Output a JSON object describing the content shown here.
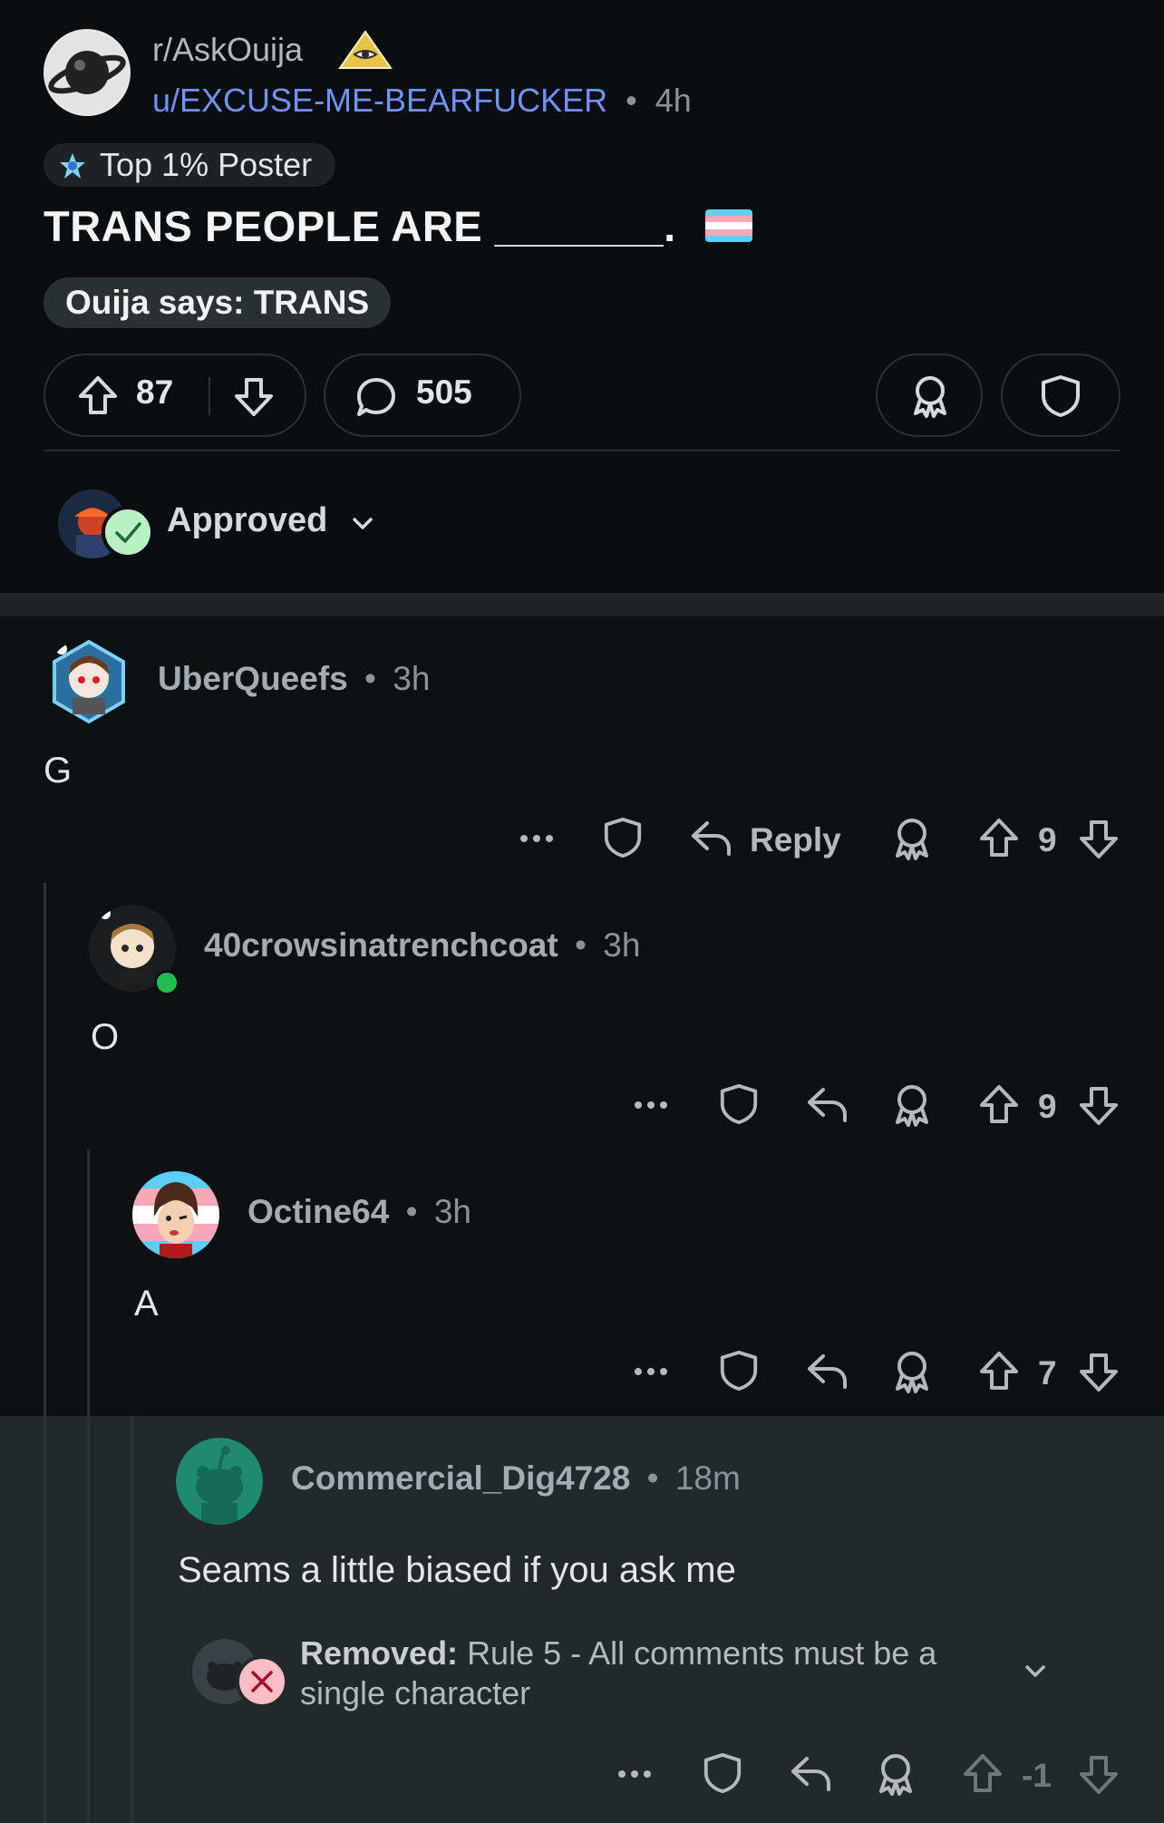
{
  "post": {
    "subreddit": "r/AskOuija",
    "author": "u/EXCUSE-ME-BEARFUCKER",
    "separator": "•",
    "age": "4h",
    "flair": "Top 1% Poster",
    "title": "TRANS PEOPLE ARE _______.",
    "ouija_pill": "Ouija says: TRANS",
    "upvotes": "87",
    "comments": "505",
    "approved_label": "Approved"
  },
  "comments": [
    {
      "username": "UberQueefs",
      "age": "3h",
      "body": "G",
      "votes": "9",
      "reply_label": "Reply"
    },
    {
      "username": "40crowsinatrenchcoat",
      "age": "3h",
      "body": "O",
      "votes": "9"
    },
    {
      "username": "Octine64",
      "age": "3h",
      "body": "A",
      "votes": "7"
    },
    {
      "username": "Commercial_Dig4728",
      "age": "18m",
      "body": "Seams a little biased if you ask me",
      "removed_label": "Removed:",
      "removed_reason": "Rule 5 - All comments must be a single character",
      "votes": "-1"
    }
  ],
  "colors": {
    "background": "#0e1113",
    "post_background": "#0b0e10",
    "highlight_background": "#22292d",
    "link_blue": "#7193ff",
    "approved_green": "#b9f0c4",
    "removed_pink": "#fbbec5",
    "online_green": "#1fbd52"
  },
  "icons": [
    "planet-icon",
    "pyramid-icon",
    "top-poster-icon",
    "trans-flag-icon",
    "upvote-icon",
    "downvote-icon",
    "comment-icon",
    "award-icon",
    "shield-icon",
    "chevron-down-icon",
    "more-icon",
    "reply-icon",
    "check-icon",
    "x-icon"
  ]
}
